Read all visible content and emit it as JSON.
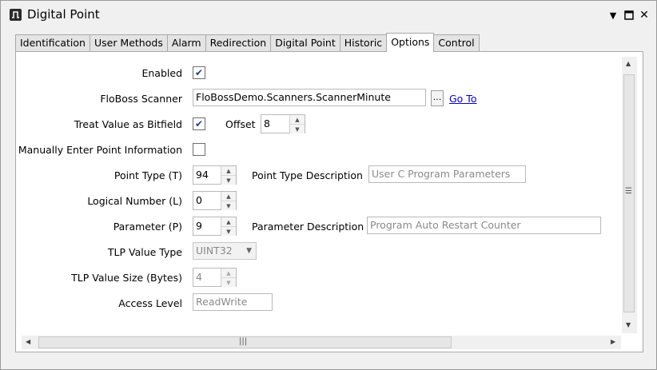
{
  "window": {
    "title": "Digital Point"
  },
  "titlebar_icons": {
    "menu": "▼",
    "maximize": "☐",
    "close": "✕"
  },
  "tabs": [
    {
      "label": "Identification",
      "active": false
    },
    {
      "label": "User Methods",
      "active": false
    },
    {
      "label": "Alarm",
      "active": false
    },
    {
      "label": "Redirection",
      "active": false
    },
    {
      "label": "Digital Point",
      "active": false
    },
    {
      "label": "Historic",
      "active": false
    },
    {
      "label": "Options",
      "active": true
    },
    {
      "label": "Control",
      "active": false
    }
  ],
  "form": {
    "enabled": {
      "label": "Enabled",
      "checked": true
    },
    "scanner": {
      "label": "FloBoss Scanner",
      "value": "FloBossDemo.Scanners.ScannerMinute",
      "browse": "...",
      "goto": "Go To"
    },
    "bitfield": {
      "label": "Treat Value as Bitfield",
      "checked": true,
      "offset_label": "Offset",
      "offset_value": "8"
    },
    "manual": {
      "label": "Manually Enter Point Information",
      "checked": false
    },
    "point_type": {
      "label": "Point Type (T)",
      "value": "94",
      "desc_label": "Point Type Description",
      "desc_value": "User C Program Parameters"
    },
    "logical": {
      "label": "Logical Number (L)",
      "value": "0"
    },
    "parameter": {
      "label": "Parameter (P)",
      "value": "9",
      "desc_label": "Parameter Description",
      "desc_value": "Program Auto Restart Counter"
    },
    "tlp_type": {
      "label": "TLP Value Type",
      "value": "UINT32"
    },
    "tlp_size": {
      "label": "TLP Value Size (Bytes)",
      "value": "4"
    },
    "access": {
      "label": "Access Level",
      "value": "ReadWrite"
    }
  },
  "check_mark": "✔"
}
